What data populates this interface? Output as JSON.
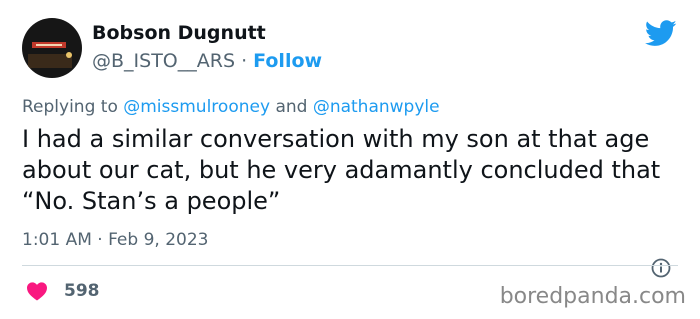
{
  "author": {
    "display_name": "Bobson Dugnutt",
    "handle": "@B_ISTO__ARS",
    "separator": "·",
    "follow_label": "Follow"
  },
  "reply": {
    "prefix": "Replying to",
    "mention1": "@missmulrooney",
    "connector": "and",
    "mention2": "@nathanwpyle"
  },
  "tweet": {
    "text": "I had a similar conversation with my son at that age about our cat, but he very adamantly concluded that “No. Stan’s a people”"
  },
  "meta": {
    "timestamp": "1:01 AM · Feb 9, 2023",
    "like_count": "598"
  },
  "watermark": "boredpanda.com",
  "icons": {
    "brand": "twitter-bird-icon",
    "like": "heart-icon",
    "info": "info-icon"
  },
  "colors": {
    "link_blue": "#1d9bf0",
    "like_pink": "#f91880",
    "text_primary": "#0f1419",
    "text_secondary": "#536471"
  }
}
